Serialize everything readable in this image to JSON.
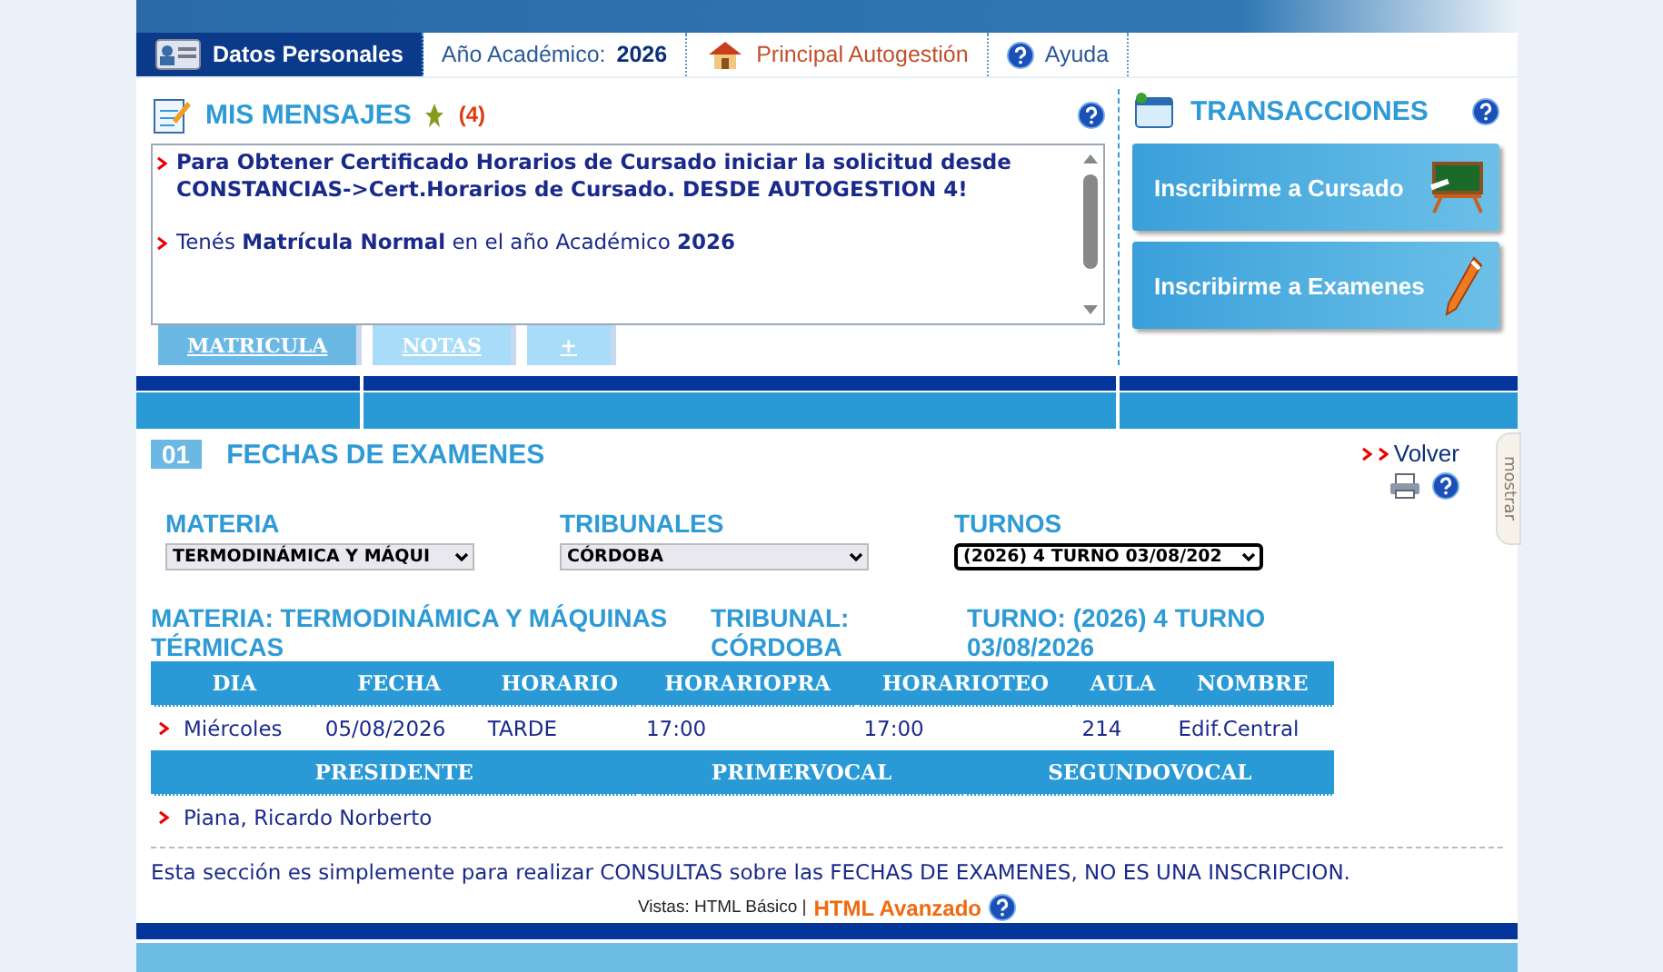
{
  "nav": {
    "tabs": [
      {
        "kind": "profile",
        "label": "Datos Personales",
        "selected": true
      },
      {
        "kind": "year",
        "label": "Año Académico:",
        "value": "2026",
        "selected": false
      },
      {
        "kind": "home",
        "label": "Principal Autogestión",
        "selected": false
      },
      {
        "kind": "help",
        "label": "Ayuda",
        "selected": false
      }
    ]
  },
  "messages": {
    "title": "MIS MENSAJES",
    "count": "(4)",
    "items": [
      {
        "text": "**Para Obtener Certificado Horarios de Cursado iniciar la solicitud desde CONSTANCIAS->Cert.Horarios de Cursado. DESDE AUTOGESTION 4!**"
      },
      {
        "text": "Tenés **Matrícula Normal** en el año Académico **2026**"
      }
    ],
    "tabs": [
      {
        "label": "MATRICULA",
        "selected": true
      },
      {
        "label": "NOTAS",
        "selected": false
      },
      {
        "label": "+",
        "selected": false
      }
    ]
  },
  "transactions": {
    "title": "TRANSACCIONES",
    "buttons": [
      {
        "kind": "chalkboard",
        "label": "Inscribirme a Cursado"
      },
      {
        "kind": "pencil",
        "label": "Inscribirme a Examenes"
      }
    ]
  },
  "exams": {
    "number": "01",
    "title": "FECHAS DE EXAMENES",
    "back": "Volver",
    "side_tab": "mostrar",
    "filters": [
      {
        "label": "MATERIA",
        "value": "TERMODINÁMICA Y MÁQUI",
        "focused": false
      },
      {
        "label": "TRIBUNALES",
        "value": "CÓRDOBA",
        "focused": false
      },
      {
        "label": "TURNOS",
        "value": "(2026) 4 TURNO 03/08/202",
        "focused": true
      }
    ],
    "summary": [
      "MATERIA: TERMODINÁMICA Y MÁQUINAS TÉRMICAS",
      "TRIBUNAL: CÓRDOBA",
      "TURNO: (2026) 4 TURNO 03/08/2026"
    ],
    "schedule": {
      "columns": [
        "DIA",
        "FECHA",
        "HORARIO",
        "HORARIOPRA",
        "HORARIOTEO",
        "AULA",
        "NOMBRE"
      ],
      "rows": [
        [
          "Miércoles",
          "05/08/2026",
          "TARDE",
          "17:00",
          "17:00",
          "214",
          "Edif.Central"
        ]
      ]
    },
    "jury": {
      "columns": [
        "PRESIDENTE",
        "PRIMERVOCAL",
        "SEGUNDOVOCAL"
      ],
      "rows": [
        [
          "Piana, Ricardo Norberto",
          "",
          ""
        ]
      ]
    },
    "note": "Esta sección es simplemente para realizar CONSULTAS sobre las FECHAS DE EXAMENES, NO ES UNA INSCRIPCION.",
    "views": {
      "label": "Vistas: HTML Básico |",
      "advanced": "HTML Avanzado"
    }
  }
}
